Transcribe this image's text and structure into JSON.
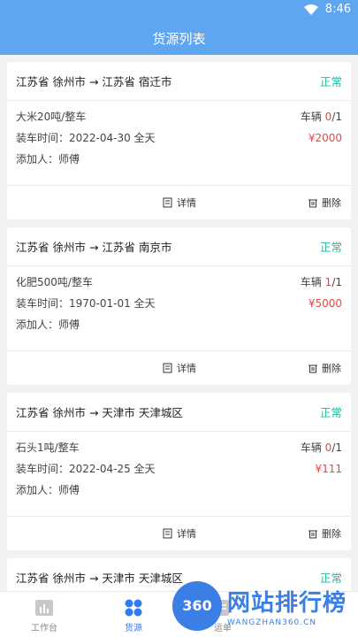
{
  "status_bar": {
    "time": "8:46"
  },
  "header": {
    "title": "货源列表"
  },
  "cards": [
    {
      "route": "江苏省 徐州市 → 江苏省 宿迁市",
      "status": "正常",
      "cargo": "大米20吨/整车",
      "vehicle_label": "车辆",
      "vehicle_used": "0",
      "vehicle_total": "/1",
      "load_time": "装车时间：2022-04-30 全天",
      "price": "¥2000",
      "adder": "添加人：师傅",
      "detail_label": "详情",
      "delete_label": "删除"
    },
    {
      "route": "江苏省 徐州市 → 江苏省 南京市",
      "status": "正常",
      "cargo": "化肥500吨/整车",
      "vehicle_label": "车辆",
      "vehicle_used": "1",
      "vehicle_total": "/1",
      "load_time": "装车时间：1970-01-01 全天",
      "price": "¥5000",
      "adder": "添加人：师傅",
      "detail_label": "详情",
      "delete_label": "删除"
    },
    {
      "route": "江苏省 徐州市 → 天津市 天津城区",
      "status": "正常",
      "cargo": "石头1吨/整车",
      "vehicle_label": "车辆",
      "vehicle_used": "0",
      "vehicle_total": "/1",
      "load_time": "装车时间：2022-04-25 全天",
      "price": "¥111",
      "adder": "添加人：师傅",
      "detail_label": "详情",
      "delete_label": "删除"
    },
    {
      "route": "江苏省 徐州市 → 天津市 天津城区",
      "status": "正常"
    }
  ],
  "tabbar": [
    {
      "label": "工作台"
    },
    {
      "label": "货源"
    },
    {
      "label": "运单"
    }
  ],
  "watermark": {
    "logo": "360",
    "text": "网站排行榜",
    "sub": "WANGZHAN360.CN"
  },
  "colors": {
    "header": "#5ea6f0",
    "status_ok": "#26b8a0",
    "price": "#e84646",
    "tab_active": "#2d7ef2"
  }
}
